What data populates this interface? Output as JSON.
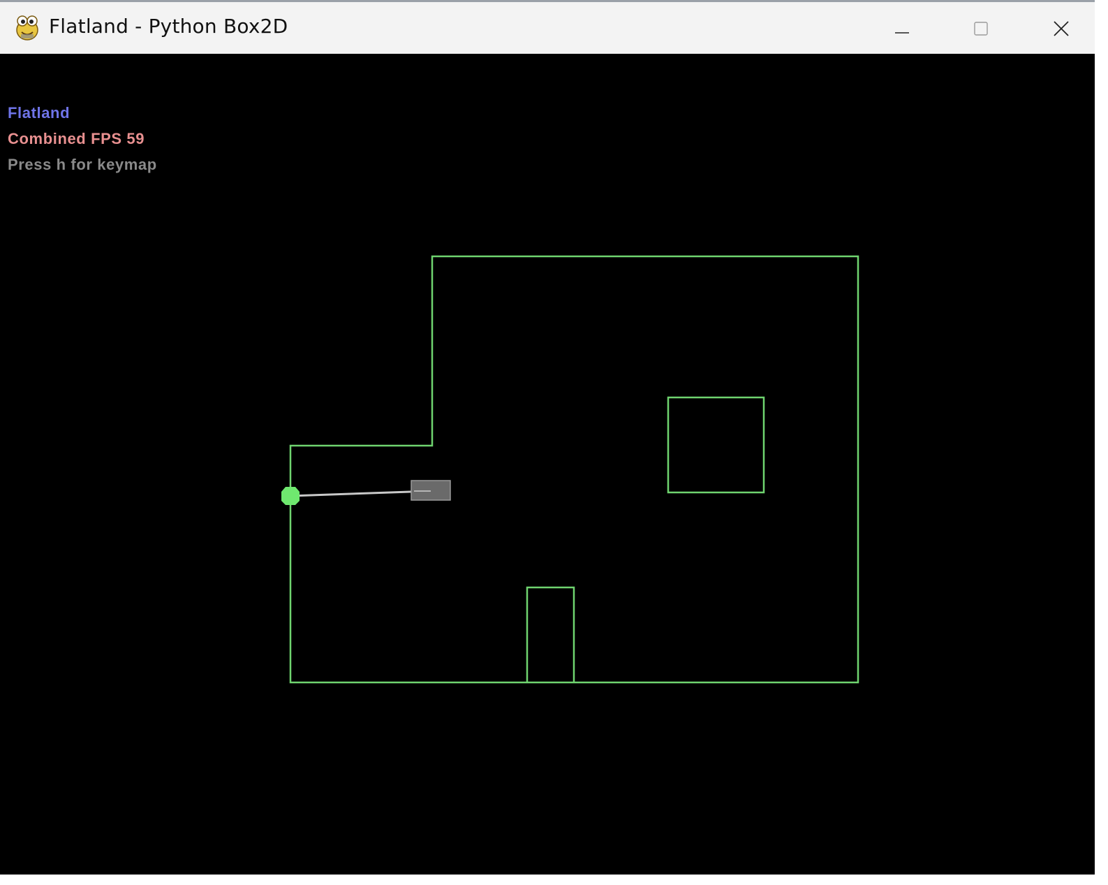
{
  "window": {
    "title": "Flatland - Python Box2D",
    "icon": "pygame-snake-icon",
    "controls": {
      "minimize_icon": "minimize-icon",
      "maximize_icon": "maximize-icon",
      "close_icon": "close-icon"
    }
  },
  "hud": {
    "title": "Flatland",
    "title_color": "#6f74e8",
    "fps_text": "Combined FPS 59",
    "fps_color": "#e89090",
    "help_text": "Press h for keymap",
    "help_color": "#8a8a8a"
  },
  "scene": {
    "background_color": "#000000",
    "wall_color": "#6fd46f",
    "agent_color": "#6fe86f",
    "vehicle_color": "#6a6a6a",
    "tether_color": "#c8c8c8"
  }
}
